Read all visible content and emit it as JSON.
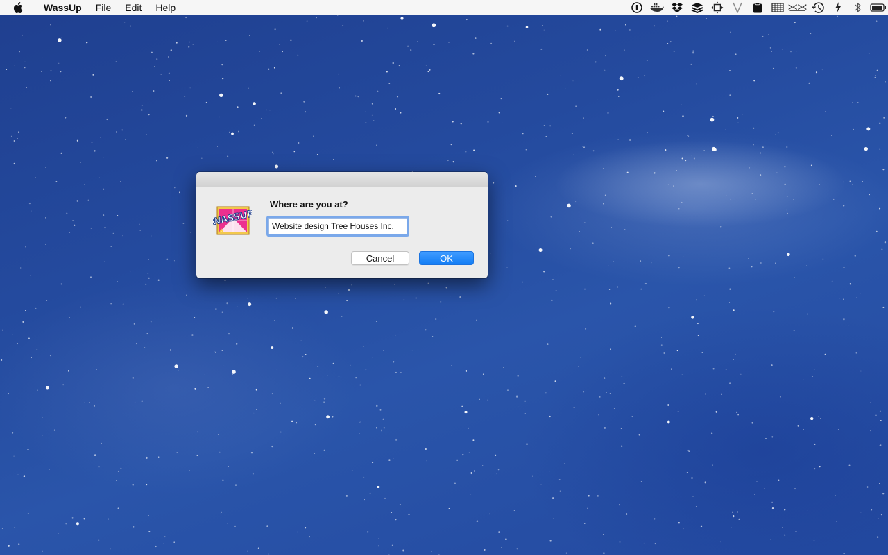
{
  "menubar": {
    "app_name": "WassUp",
    "menus": [
      "File",
      "Edit",
      "Help"
    ],
    "status_icons": [
      "1password-icon",
      "docker-icon",
      "dropbox-icon",
      "buffer-icon",
      "move-icon",
      "vectorize-icon",
      "clipboard-icon",
      "grid-icon",
      "rays-icon",
      "time-machine-icon",
      "power-icon",
      "bluetooth-icon",
      "battery-icon"
    ]
  },
  "dialog": {
    "icon_label": "WASSUP",
    "prompt": "Where are you at?",
    "input_value": "Website design Tree Houses Inc.",
    "cancel_label": "Cancel",
    "ok_label": "OK"
  },
  "colors": {
    "desktop_base": "#2a55aa",
    "accent_button": "#137ef5",
    "focus_ring": "#7aa8ea"
  }
}
